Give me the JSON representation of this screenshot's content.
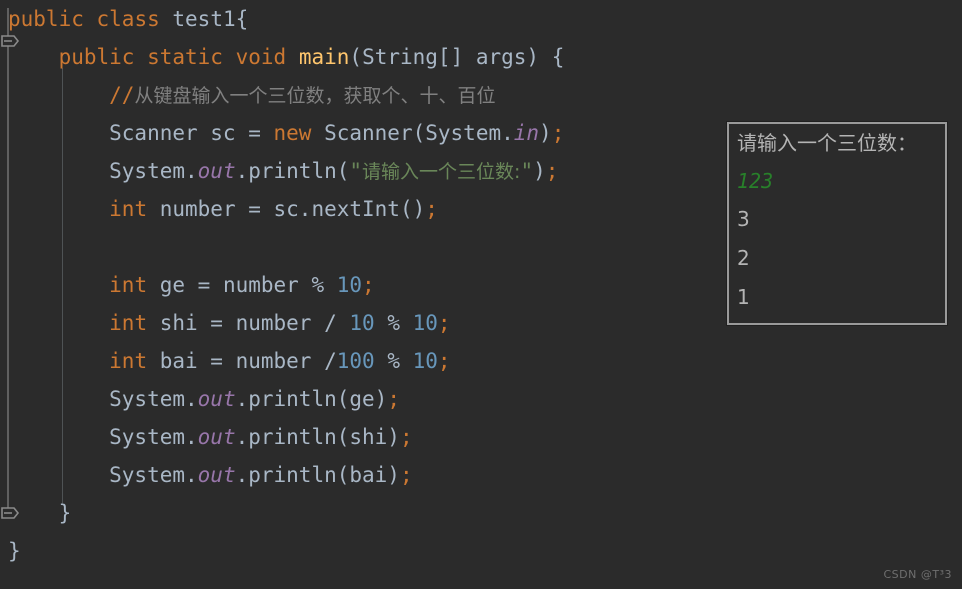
{
  "editor": {
    "theme_background": "#2b2b2b",
    "default_text_color": "#a9b7c6",
    "keyword_color": "#cc7832",
    "string_color": "#6a8759",
    "number_color": "#6897bb",
    "comment_color": "#808080",
    "method_color": "#ffc66d",
    "field_color": "#9876aa",
    "lines": [
      {
        "id": "line-1",
        "tokens": [
          {
            "t": "public",
            "c": "kw"
          },
          {
            "t": " ",
            "c": "punc"
          },
          {
            "t": "class",
            "c": "kw"
          },
          {
            "t": " ",
            "c": "punc"
          },
          {
            "t": "test1",
            "c": "ident"
          },
          {
            "t": "{",
            "c": "punc"
          }
        ]
      },
      {
        "id": "line-2",
        "tokens": [
          {
            "t": "    ",
            "c": "punc"
          },
          {
            "t": "public",
            "c": "kw"
          },
          {
            "t": " ",
            "c": "punc"
          },
          {
            "t": "static",
            "c": "kw"
          },
          {
            "t": " ",
            "c": "punc"
          },
          {
            "t": "void",
            "c": "kw"
          },
          {
            "t": " ",
            "c": "punc"
          },
          {
            "t": "main",
            "c": "meth"
          },
          {
            "t": "(String[] args) {",
            "c": "ident"
          }
        ]
      },
      {
        "id": "line-3",
        "tokens": [
          {
            "t": "        ",
            "c": "punc"
          },
          {
            "t": "//",
            "c": "cmtslash"
          },
          {
            "t": "从键盘输入一个三位数，获取个、十、百位",
            "c": "cmt cjk"
          }
        ]
      },
      {
        "id": "line-4",
        "tokens": [
          {
            "t": "        Scanner sc = ",
            "c": "ident"
          },
          {
            "t": "new",
            "c": "kw"
          },
          {
            "t": " Scanner(System.",
            "c": "ident"
          },
          {
            "t": "in",
            "c": "fld"
          },
          {
            "t": ")",
            "c": "ident"
          },
          {
            "t": ";",
            "c": "semi"
          }
        ]
      },
      {
        "id": "line-5",
        "tokens": [
          {
            "t": "        System.",
            "c": "ident"
          },
          {
            "t": "out",
            "c": "fld"
          },
          {
            "t": ".println(",
            "c": "ident"
          },
          {
            "t": "\"",
            "c": "str"
          },
          {
            "t": "请输入一个三位数:",
            "c": "str cjk"
          },
          {
            "t": "\"",
            "c": "str"
          },
          {
            "t": ")",
            "c": "ident"
          },
          {
            "t": ";",
            "c": "semi"
          }
        ]
      },
      {
        "id": "line-6",
        "tokens": [
          {
            "t": "        ",
            "c": "punc"
          },
          {
            "t": "int",
            "c": "kw"
          },
          {
            "t": " number = sc.nextInt()",
            "c": "ident"
          },
          {
            "t": ";",
            "c": "semi"
          }
        ]
      },
      {
        "id": "line-7",
        "tokens": []
      },
      {
        "id": "line-8",
        "tokens": [
          {
            "t": "        ",
            "c": "punc"
          },
          {
            "t": "int",
            "c": "kw"
          },
          {
            "t": " ge = number % ",
            "c": "ident"
          },
          {
            "t": "10",
            "c": "num"
          },
          {
            "t": ";",
            "c": "semi"
          }
        ]
      },
      {
        "id": "line-9",
        "tokens": [
          {
            "t": "        ",
            "c": "punc"
          },
          {
            "t": "int",
            "c": "kw"
          },
          {
            "t": " shi = number / ",
            "c": "ident"
          },
          {
            "t": "10",
            "c": "num"
          },
          {
            "t": " % ",
            "c": "ident"
          },
          {
            "t": "10",
            "c": "num"
          },
          {
            "t": ";",
            "c": "semi"
          }
        ]
      },
      {
        "id": "line-10",
        "tokens": [
          {
            "t": "        ",
            "c": "punc"
          },
          {
            "t": "int",
            "c": "kw"
          },
          {
            "t": " bai = number /",
            "c": "ident"
          },
          {
            "t": "100",
            "c": "num"
          },
          {
            "t": " % ",
            "c": "ident"
          },
          {
            "t": "10",
            "c": "num"
          },
          {
            "t": ";",
            "c": "semi"
          }
        ]
      },
      {
        "id": "line-11",
        "tokens": [
          {
            "t": "        System.",
            "c": "ident"
          },
          {
            "t": "out",
            "c": "fld"
          },
          {
            "t": ".println(ge)",
            "c": "ident"
          },
          {
            "t": ";",
            "c": "semi"
          }
        ]
      },
      {
        "id": "line-12",
        "tokens": [
          {
            "t": "        System.",
            "c": "ident"
          },
          {
            "t": "out",
            "c": "fld"
          },
          {
            "t": ".println(shi)",
            "c": "ident"
          },
          {
            "t": ";",
            "c": "semi"
          }
        ]
      },
      {
        "id": "line-13",
        "tokens": [
          {
            "t": "        System.",
            "c": "ident"
          },
          {
            "t": "out",
            "c": "fld"
          },
          {
            "t": ".println(bai)",
            "c": "ident"
          },
          {
            "t": ";",
            "c": "semi"
          }
        ]
      },
      {
        "id": "line-14",
        "tokens": [
          {
            "t": "    }",
            "c": "ident"
          }
        ]
      },
      {
        "id": "line-15",
        "tokens": [
          {
            "t": "}",
            "c": "ident"
          }
        ]
      }
    ],
    "plain_source": "public class test1{\n    public static void main(String[] args) {\n        //从键盘输入一个三位数，获取个、十、百位\n        Scanner sc = new Scanner(System.in);\n        System.out.println(\"请输入一个三位数:\");\n        int number = sc.nextInt();\n\n        int ge = number % 10;\n        int shi = number / 10 % 10;\n        int bai = number /100 % 10;\n        System.out.println(ge);\n        System.out.println(shi);\n        System.out.println(bai);\n    }\n}"
  },
  "gutter": {
    "fold_top_label": "collapse-block-top",
    "fold_bottom_label": "collapse-block-bottom"
  },
  "console": {
    "border_color": "#9a9a9a",
    "background": "#2b2b2b",
    "lines": [
      {
        "id": "console-line-1",
        "text": "请输入一个三位数：",
        "kind": "output"
      },
      {
        "id": "console-line-2",
        "text": "123",
        "kind": "input"
      },
      {
        "id": "console-line-3",
        "text": "3",
        "kind": "output"
      },
      {
        "id": "console-line-4",
        "text": "2",
        "kind": "output"
      },
      {
        "id": "console-line-5",
        "text": "1",
        "kind": "output"
      }
    ],
    "input_color": "#28802a"
  },
  "watermark": {
    "text": "CSDN @T³3"
  }
}
